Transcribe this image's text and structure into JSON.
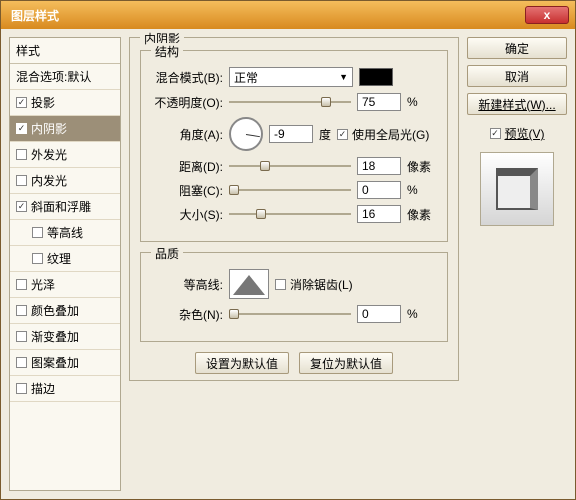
{
  "title": "图层样式",
  "close": "x",
  "sidebar": {
    "header": "样式",
    "blendDefaults": "混合选项:默认",
    "items": [
      {
        "label": "投影",
        "checked": true
      },
      {
        "label": "内阴影",
        "checked": true,
        "selected": true
      },
      {
        "label": "外发光",
        "checked": false
      },
      {
        "label": "内发光",
        "checked": false
      },
      {
        "label": "斜面和浮雕",
        "checked": true
      },
      {
        "label": "等高线",
        "indent": true,
        "checked": false
      },
      {
        "label": "纹理",
        "indent": true,
        "checked": false
      },
      {
        "label": "光泽",
        "checked": false
      },
      {
        "label": "颜色叠加",
        "checked": false
      },
      {
        "label": "渐变叠加",
        "checked": false
      },
      {
        "label": "图案叠加",
        "checked": false
      },
      {
        "label": "描边",
        "checked": false
      }
    ]
  },
  "panel": {
    "title": "内阴影",
    "structure": {
      "legend": "结构",
      "blendMode": {
        "label": "混合模式(B):",
        "value": "正常"
      },
      "opacity": {
        "label": "不透明度(O):",
        "value": "75",
        "unit": "%",
        "pos": 75
      },
      "angle": {
        "label": "角度(A):",
        "value": "-9",
        "unit": "度"
      },
      "globalLight": {
        "label": "使用全局光(G)",
        "checked": true
      },
      "distance": {
        "label": "距离(D):",
        "value": "18",
        "unit": "像素",
        "pos": 25
      },
      "choke": {
        "label": "阻塞(C):",
        "value": "0",
        "unit": "%",
        "pos": 0
      },
      "size": {
        "label": "大小(S):",
        "value": "16",
        "unit": "像素",
        "pos": 22
      }
    },
    "quality": {
      "legend": "品质",
      "contour": {
        "label": "等高线:"
      },
      "antiAlias": {
        "label": "消除锯齿(L)",
        "checked": false
      },
      "noise": {
        "label": "杂色(N):",
        "value": "0",
        "unit": "%",
        "pos": 0
      }
    },
    "buttons": {
      "setDefault": "设置为默认值",
      "resetDefault": "复位为默认值"
    }
  },
  "right": {
    "ok": "确定",
    "cancel": "取消",
    "newStyle": "新建样式(W)...",
    "preview": {
      "label": "预览(V)",
      "checked": true
    }
  }
}
